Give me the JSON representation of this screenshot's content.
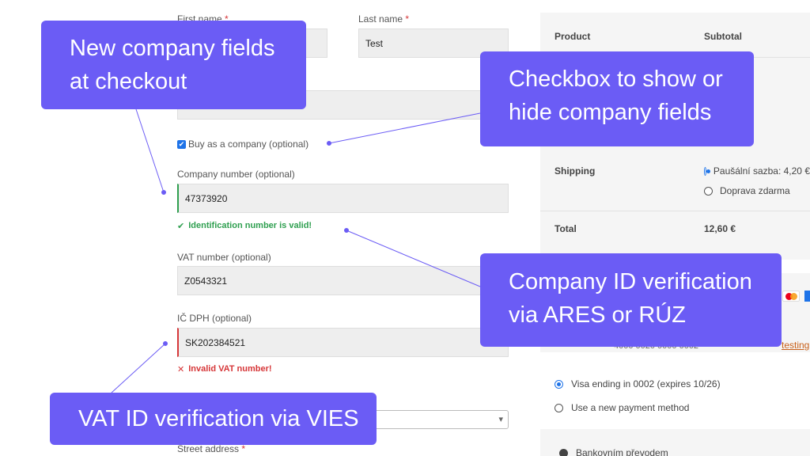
{
  "form": {
    "first_name_label": "First name",
    "last_name_label": "Last name",
    "last_name_value": "Test",
    "required_mark": "*",
    "buy_as_company_label": "Buy as a company (optional)",
    "company_number_label": "Company number (optional)",
    "company_number_value": "47373920",
    "company_number_ok": "Identification number is valid!",
    "vat_number_label": "VAT number (optional)",
    "vat_number_value": "Z0543321",
    "ic_dph_label": "IČ DPH (optional)",
    "ic_dph_value": "SK202384521",
    "ic_dph_error": "Invalid VAT number!",
    "street_address_label": "Street address",
    "check_glyph": "✔",
    "error_glyph": "✕",
    "dropdown_glyph": "▾"
  },
  "summary": {
    "product_header": "Product",
    "subtotal_header": "Subtotal",
    "shipping_label": "Shipping",
    "shipping_option_1": "Paušální sazba: 4,20 €",
    "shipping_option_2": "Doprava zdarma",
    "total_label": "Total",
    "total_value": "12,60 €"
  },
  "payment": {
    "card_partial": "4000 0020 0000 0002",
    "testing_link": "testing",
    "saved_card": "Visa ending in 0002 (expires 10/26)",
    "new_method": "Use a new payment method",
    "bank_transfer": "Bankovním převodem"
  },
  "callouts": {
    "company_fields_line1": "New company fields",
    "company_fields_line2": "at checkout",
    "checkbox_line1": "Checkbox to show or",
    "checkbox_line2": "hide company fields",
    "company_id_line1": "Company ID verification",
    "company_id_line2": "via ARES or RÚZ",
    "vat_id": "VAT ID verification via VIES"
  },
  "colors": {
    "callout": "#6b5cf5",
    "valid": "#2e9f4f",
    "invalid": "#d63638",
    "accent": "#1e73e8"
  }
}
